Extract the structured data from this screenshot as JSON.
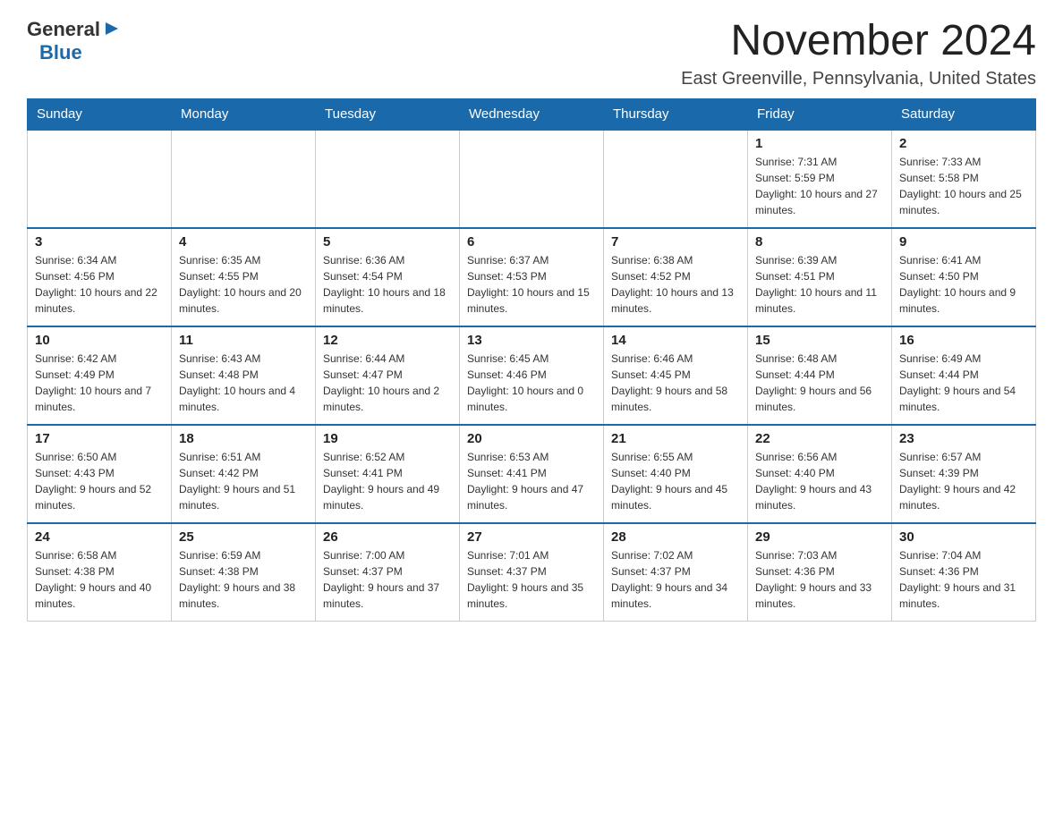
{
  "header": {
    "logo_general": "General",
    "logo_blue": "Blue",
    "title": "November 2024",
    "subtitle": "East Greenville, Pennsylvania, United States"
  },
  "weekdays": [
    "Sunday",
    "Monday",
    "Tuesday",
    "Wednesday",
    "Thursday",
    "Friday",
    "Saturday"
  ],
  "weeks": [
    [
      {
        "day": "",
        "sunrise": "",
        "sunset": "",
        "daylight": ""
      },
      {
        "day": "",
        "sunrise": "",
        "sunset": "",
        "daylight": ""
      },
      {
        "day": "",
        "sunrise": "",
        "sunset": "",
        "daylight": ""
      },
      {
        "day": "",
        "sunrise": "",
        "sunset": "",
        "daylight": ""
      },
      {
        "day": "",
        "sunrise": "",
        "sunset": "",
        "daylight": ""
      },
      {
        "day": "1",
        "sunrise": "Sunrise: 7:31 AM",
        "sunset": "Sunset: 5:59 PM",
        "daylight": "Daylight: 10 hours and 27 minutes."
      },
      {
        "day": "2",
        "sunrise": "Sunrise: 7:33 AM",
        "sunset": "Sunset: 5:58 PM",
        "daylight": "Daylight: 10 hours and 25 minutes."
      }
    ],
    [
      {
        "day": "3",
        "sunrise": "Sunrise: 6:34 AM",
        "sunset": "Sunset: 4:56 PM",
        "daylight": "Daylight: 10 hours and 22 minutes."
      },
      {
        "day": "4",
        "sunrise": "Sunrise: 6:35 AM",
        "sunset": "Sunset: 4:55 PM",
        "daylight": "Daylight: 10 hours and 20 minutes."
      },
      {
        "day": "5",
        "sunrise": "Sunrise: 6:36 AM",
        "sunset": "Sunset: 4:54 PM",
        "daylight": "Daylight: 10 hours and 18 minutes."
      },
      {
        "day": "6",
        "sunrise": "Sunrise: 6:37 AM",
        "sunset": "Sunset: 4:53 PM",
        "daylight": "Daylight: 10 hours and 15 minutes."
      },
      {
        "day": "7",
        "sunrise": "Sunrise: 6:38 AM",
        "sunset": "Sunset: 4:52 PM",
        "daylight": "Daylight: 10 hours and 13 minutes."
      },
      {
        "day": "8",
        "sunrise": "Sunrise: 6:39 AM",
        "sunset": "Sunset: 4:51 PM",
        "daylight": "Daylight: 10 hours and 11 minutes."
      },
      {
        "day": "9",
        "sunrise": "Sunrise: 6:41 AM",
        "sunset": "Sunset: 4:50 PM",
        "daylight": "Daylight: 10 hours and 9 minutes."
      }
    ],
    [
      {
        "day": "10",
        "sunrise": "Sunrise: 6:42 AM",
        "sunset": "Sunset: 4:49 PM",
        "daylight": "Daylight: 10 hours and 7 minutes."
      },
      {
        "day": "11",
        "sunrise": "Sunrise: 6:43 AM",
        "sunset": "Sunset: 4:48 PM",
        "daylight": "Daylight: 10 hours and 4 minutes."
      },
      {
        "day": "12",
        "sunrise": "Sunrise: 6:44 AM",
        "sunset": "Sunset: 4:47 PM",
        "daylight": "Daylight: 10 hours and 2 minutes."
      },
      {
        "day": "13",
        "sunrise": "Sunrise: 6:45 AM",
        "sunset": "Sunset: 4:46 PM",
        "daylight": "Daylight: 10 hours and 0 minutes."
      },
      {
        "day": "14",
        "sunrise": "Sunrise: 6:46 AM",
        "sunset": "Sunset: 4:45 PM",
        "daylight": "Daylight: 9 hours and 58 minutes."
      },
      {
        "day": "15",
        "sunrise": "Sunrise: 6:48 AM",
        "sunset": "Sunset: 4:44 PM",
        "daylight": "Daylight: 9 hours and 56 minutes."
      },
      {
        "day": "16",
        "sunrise": "Sunrise: 6:49 AM",
        "sunset": "Sunset: 4:44 PM",
        "daylight": "Daylight: 9 hours and 54 minutes."
      }
    ],
    [
      {
        "day": "17",
        "sunrise": "Sunrise: 6:50 AM",
        "sunset": "Sunset: 4:43 PM",
        "daylight": "Daylight: 9 hours and 52 minutes."
      },
      {
        "day": "18",
        "sunrise": "Sunrise: 6:51 AM",
        "sunset": "Sunset: 4:42 PM",
        "daylight": "Daylight: 9 hours and 51 minutes."
      },
      {
        "day": "19",
        "sunrise": "Sunrise: 6:52 AM",
        "sunset": "Sunset: 4:41 PM",
        "daylight": "Daylight: 9 hours and 49 minutes."
      },
      {
        "day": "20",
        "sunrise": "Sunrise: 6:53 AM",
        "sunset": "Sunset: 4:41 PM",
        "daylight": "Daylight: 9 hours and 47 minutes."
      },
      {
        "day": "21",
        "sunrise": "Sunrise: 6:55 AM",
        "sunset": "Sunset: 4:40 PM",
        "daylight": "Daylight: 9 hours and 45 minutes."
      },
      {
        "day": "22",
        "sunrise": "Sunrise: 6:56 AM",
        "sunset": "Sunset: 4:40 PM",
        "daylight": "Daylight: 9 hours and 43 minutes."
      },
      {
        "day": "23",
        "sunrise": "Sunrise: 6:57 AM",
        "sunset": "Sunset: 4:39 PM",
        "daylight": "Daylight: 9 hours and 42 minutes."
      }
    ],
    [
      {
        "day": "24",
        "sunrise": "Sunrise: 6:58 AM",
        "sunset": "Sunset: 4:38 PM",
        "daylight": "Daylight: 9 hours and 40 minutes."
      },
      {
        "day": "25",
        "sunrise": "Sunrise: 6:59 AM",
        "sunset": "Sunset: 4:38 PM",
        "daylight": "Daylight: 9 hours and 38 minutes."
      },
      {
        "day": "26",
        "sunrise": "Sunrise: 7:00 AM",
        "sunset": "Sunset: 4:37 PM",
        "daylight": "Daylight: 9 hours and 37 minutes."
      },
      {
        "day": "27",
        "sunrise": "Sunrise: 7:01 AM",
        "sunset": "Sunset: 4:37 PM",
        "daylight": "Daylight: 9 hours and 35 minutes."
      },
      {
        "day": "28",
        "sunrise": "Sunrise: 7:02 AM",
        "sunset": "Sunset: 4:37 PM",
        "daylight": "Daylight: 9 hours and 34 minutes."
      },
      {
        "day": "29",
        "sunrise": "Sunrise: 7:03 AM",
        "sunset": "Sunset: 4:36 PM",
        "daylight": "Daylight: 9 hours and 33 minutes."
      },
      {
        "day": "30",
        "sunrise": "Sunrise: 7:04 AM",
        "sunset": "Sunset: 4:36 PM",
        "daylight": "Daylight: 9 hours and 31 minutes."
      }
    ]
  ]
}
